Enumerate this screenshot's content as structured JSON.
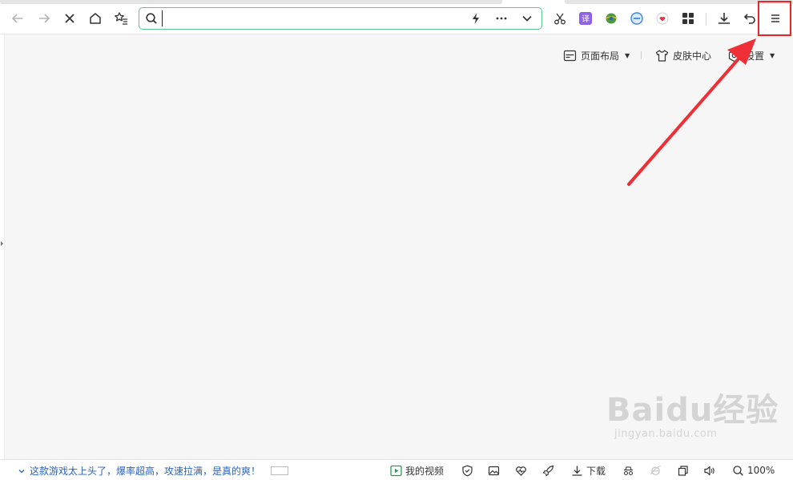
{
  "address_bar": {
    "value": "",
    "placeholder": ""
  },
  "content_toolbar": {
    "layout_label": "页面布局",
    "skin_label": "皮肤中心",
    "settings_label": "设置"
  },
  "status_bar": {
    "news_text": "这款游戏太上头了，爆率超高，攻速拉满，是真的爽！",
    "my_video_label": "我的视频",
    "download_label": "下载",
    "zoom_label": "100%"
  },
  "icons": {
    "translate_icon_text": "译"
  },
  "watermark": {
    "logo": "Baidu经验",
    "url": "jingyan.baidu.com"
  },
  "colors": {
    "address_border": "#58c88a",
    "highlight_red": "#e8262a",
    "link_blue": "#2a62c4",
    "translate_purple": "#8f63e8",
    "page_bg": "#f6f6f6"
  }
}
